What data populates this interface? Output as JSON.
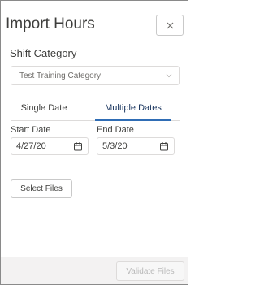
{
  "dialog": {
    "title": "Import Hours",
    "close_icon": "close-icon"
  },
  "shift_category": {
    "label": "Shift Category",
    "selected": "Test Training Category",
    "chevron_icon": "chevron-down-icon"
  },
  "tabs": [
    {
      "label": "Single Date",
      "active": false
    },
    {
      "label": "Multiple Dates",
      "active": true
    }
  ],
  "dates": {
    "start": {
      "label": "Start Date",
      "value": "4/27/20",
      "icon": "calendar-icon"
    },
    "end": {
      "label": "End Date",
      "value": "5/3/20",
      "icon": "calendar-icon"
    }
  },
  "actions": {
    "select_files": "Select Files",
    "validate_files": "Validate Files"
  },
  "colors": {
    "accent": "#2f6db5",
    "footer_bg": "#f3f2f2",
    "disabled_text": "#b9b9b9"
  }
}
